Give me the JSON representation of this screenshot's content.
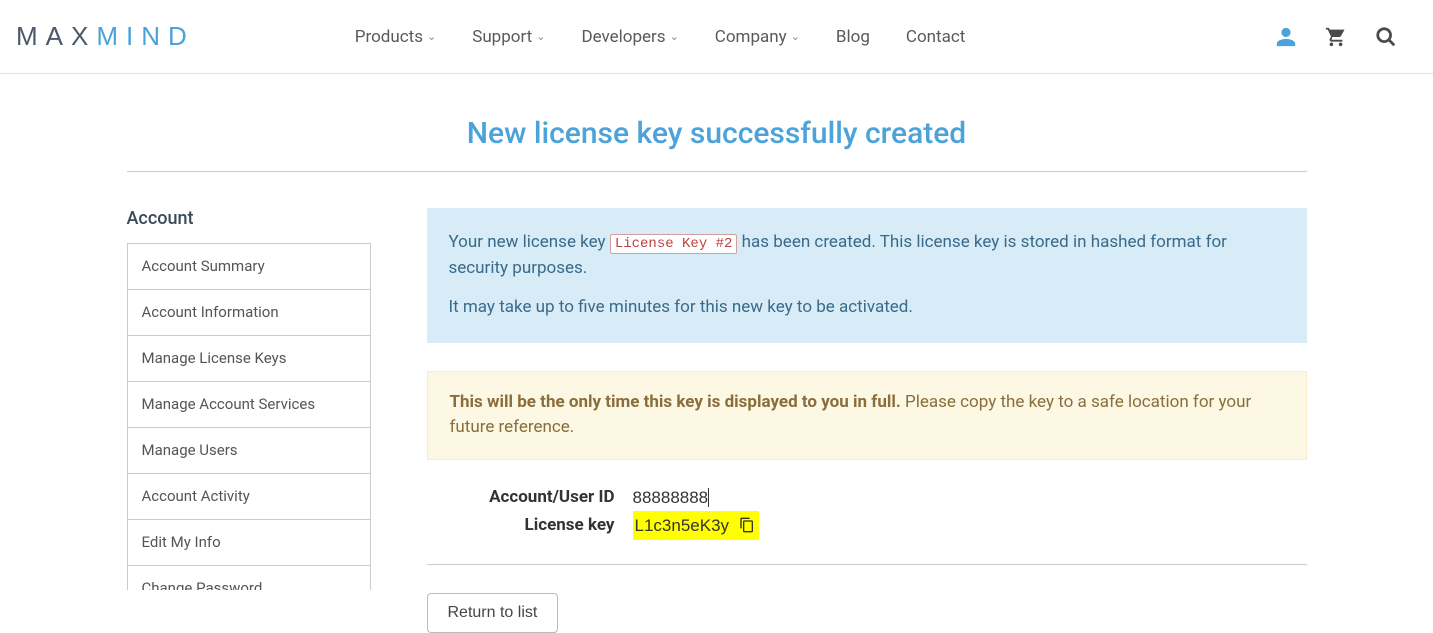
{
  "header": {
    "logo_part1": "MAX",
    "logo_part2": "MIND",
    "nav": {
      "products": "Products",
      "support": "Support",
      "developers": "Developers",
      "company": "Company",
      "blog": "Blog",
      "contact": "Contact"
    }
  },
  "page_title": "New license key successfully created",
  "sidebar": {
    "heading": "Account",
    "items": {
      "summary": "Account Summary",
      "info": "Account Information",
      "license": "Manage License Keys",
      "services": "Manage Account Services",
      "users": "Manage Users",
      "activity": "Account Activity",
      "edit": "Edit My Info",
      "password": "Change Password"
    }
  },
  "info": {
    "line1_a": "Your new license key ",
    "key_name": "License Key #2",
    "line1_b": " has been created. This license key is stored in hashed format for security purposes.",
    "line2": "It may take up to five minutes for this new key to be activated."
  },
  "warn": {
    "bold": "This will be the only time this key is displayed to you in full.",
    "rest": " Please copy the key to a safe location for your future reference."
  },
  "details": {
    "account_label": "Account/User ID",
    "account_value": "88888888",
    "license_label": "License key",
    "license_value": "L1c3n5eK3y"
  },
  "return_btn": "Return to list"
}
